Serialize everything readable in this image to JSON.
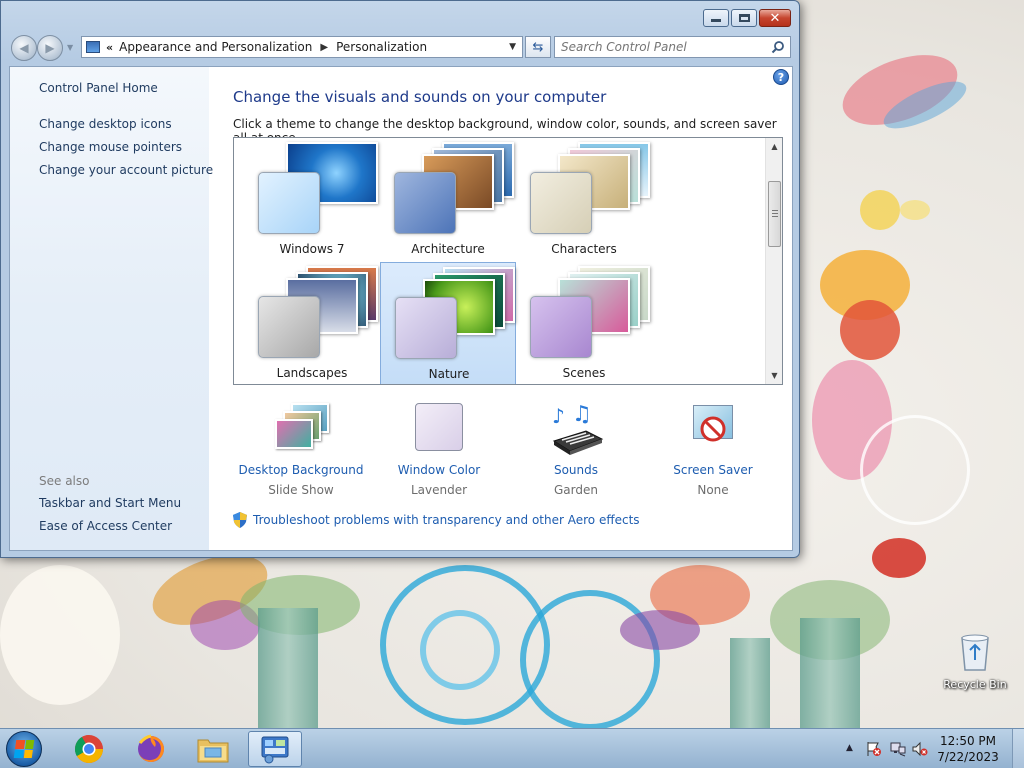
{
  "window": {
    "breadcrumb": [
      "Appearance and Personalization",
      "Personalization"
    ],
    "search_placeholder": "Search Control Panel"
  },
  "sidebar": {
    "home": "Control Panel Home",
    "links": [
      "Change desktop icons",
      "Change mouse pointers",
      "Change your account picture"
    ],
    "see_also_label": "See also",
    "see_also": [
      "Taskbar and Start Menu",
      "Ease of Access Center"
    ]
  },
  "main": {
    "title": "Change the visuals and sounds on your computer",
    "subtitle": "Click a theme to change the desktop background, window color, sounds, and screen saver all at once.",
    "themes": [
      {
        "name": "Windows 7",
        "selected": false
      },
      {
        "name": "Architecture",
        "selected": false
      },
      {
        "name": "Characters",
        "selected": false
      },
      {
        "name": "Landscapes",
        "selected": false
      },
      {
        "name": "Nature",
        "selected": true
      },
      {
        "name": "Scenes",
        "selected": false
      }
    ],
    "settings": [
      {
        "name": "Desktop Background",
        "value": "Slide Show"
      },
      {
        "name": "Window Color",
        "value": "Lavender"
      },
      {
        "name": "Sounds",
        "value": "Garden"
      },
      {
        "name": "Screen Saver",
        "value": "None"
      }
    ],
    "troubleshoot": "Troubleshoot problems with transparency and other Aero effects"
  },
  "desktop": {
    "recycle_bin": "Recycle Bin"
  },
  "taskbar": {
    "apps": [
      "Google Chrome",
      "Firefox",
      "Windows Explorer",
      "Control Panel"
    ],
    "time": "12:50 PM",
    "date": "7/22/2023"
  },
  "colors": {
    "link": "#1e5db0",
    "title": "#1e3a8a",
    "selection": "#c4ddf7",
    "window_frame": "#b5cbe3"
  }
}
